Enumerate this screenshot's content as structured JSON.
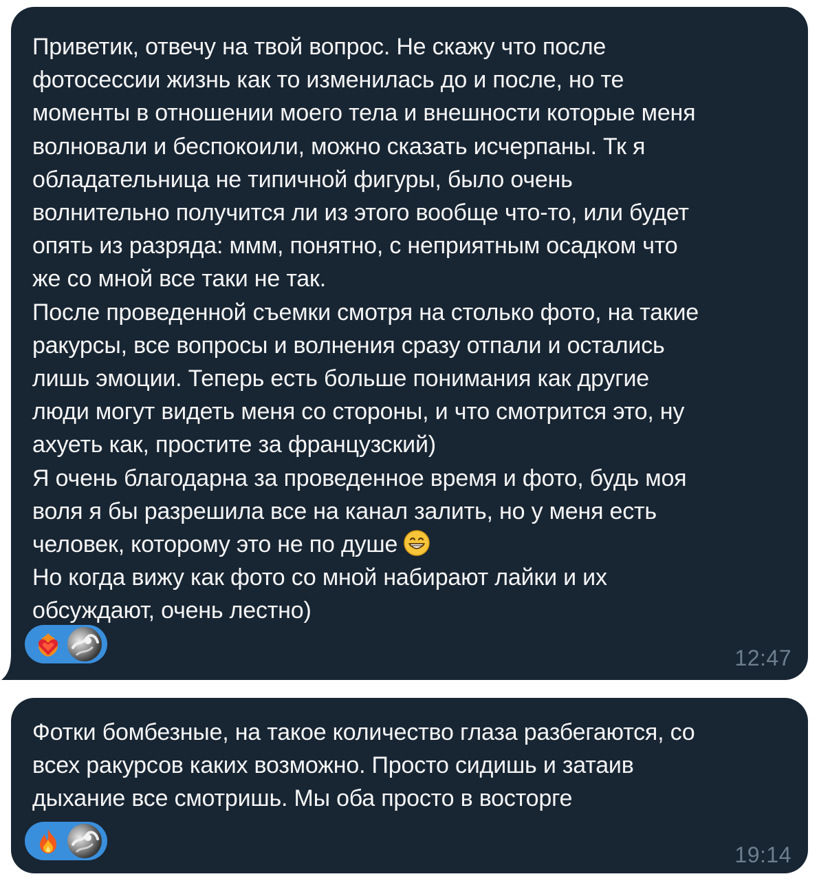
{
  "messages": [
    {
      "paragraph_1": "Приветик, отвечу на твой вопрос. Не скажу что после\nфотосессии жизнь как то изменилась до и после, но те\nмоменты в отношении моего тела и внешности которые меня\nволновали и беспокоили, можно сказать исчерпаны. Тк я\nобладательница не типичной фигуры, было очень\nволнительно получится ли из этого вообще что-то, или будет\nопять из разряда: ммм, понятно, с неприятным осадком что\nже со мной все таки не так.\nПосле проведенной съемки смотря на столько фото, на такие\nракурсы, все вопросы и волнения сразу отпали и остались\nлишь эмоции. Теперь есть больше понимания как другие\nлюди могут видеть меня со стороны, и что смотрится это, ну\nахуеть как, простите за французский)\nЯ очень благодарна за проведенное время и фото, будь моя\nволя я бы разрешила все на канал залить, но у меня есть\nчеловек, которому это не по душе",
      "paragraph_2": "Но когда вижу как фото со мной набирают лайки и их\nобсуждают, очень лестно)",
      "inline_emoji": "grinning-face-icon",
      "reaction": "heart-on-fire-icon",
      "time": "12:47"
    },
    {
      "text": "Фотки бомбезные, на такое количество глаза разбегаются, со\nвсех ракурсов каких возможно. Просто сидишь и затаив\nдыхание все смотришь. Мы оба просто в восторге",
      "reaction": "fire-icon",
      "time": "19:14"
    }
  ],
  "colors": {
    "bubble_bg": "#182533",
    "text": "#f5f5f5",
    "reaction_bg": "#3a8fdc",
    "time": "#6d7f8f"
  }
}
